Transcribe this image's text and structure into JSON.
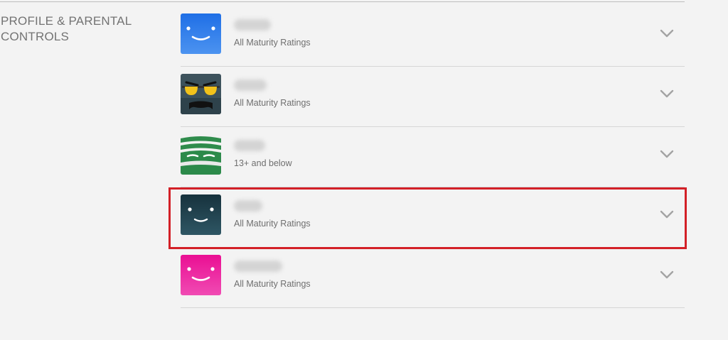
{
  "section": {
    "title": "PROFILE & PARENTAL CONTROLS"
  },
  "profiles": [
    {
      "name": "",
      "rating": "All Maturity Ratings",
      "avatar_icon": "smiley-blue-icon",
      "avatar_color": "#2f7be9"
    },
    {
      "name": "",
      "rating": "All Maturity Ratings",
      "avatar_icon": "sunglasses-mustache-icon",
      "avatar_color": "#3a4f59"
    },
    {
      "name": "",
      "rating": "13+ and below",
      "avatar_icon": "green-mummy-icon",
      "avatar_color": "#2c8a4a"
    },
    {
      "name": "",
      "rating": "All Maturity Ratings",
      "avatar_icon": "smiley-dark-teal-icon",
      "avatar_color": "#1f3c48"
    },
    {
      "name": "",
      "rating": "All Maturity Ratings",
      "avatar_icon": "smiley-pink-icon",
      "avatar_color": "#e41ea0"
    }
  ],
  "colors": {
    "highlight": "#d32027",
    "text_muted": "#737373",
    "background": "#f3f3f3"
  },
  "chevron_icon": "chevron-down-icon"
}
